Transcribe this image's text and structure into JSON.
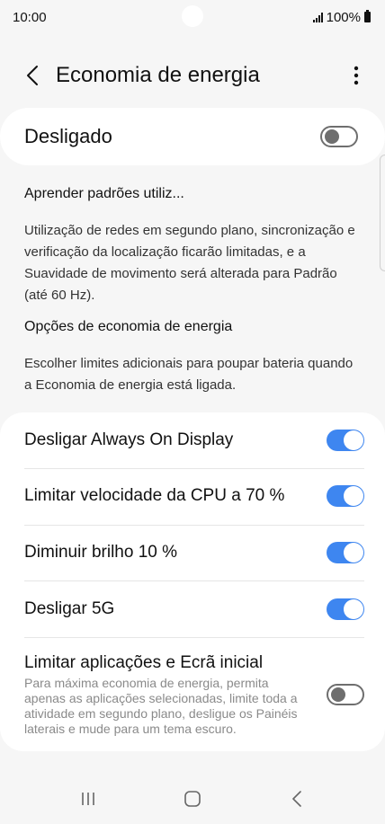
{
  "status_bar": {
    "time": "10:00",
    "battery_percent": "100%",
    "icons": [
      "signal-icon",
      "battery-icon"
    ]
  },
  "app_bar": {
    "title": "Economia de energia",
    "back_icon": "chevron-left-icon",
    "more_icon": "more-vertical-icon"
  },
  "master_switch": {
    "label": "Desligado",
    "on": false
  },
  "info": {
    "learn_heading": "Aprender padrões utiliz...",
    "learn_text": "Utilização de redes em segundo plano, sincronização e verificação da localização ficarão limitadas, e a Suavidade de movimento será alterada para Padrão (até 60 Hz).",
    "options_heading": "Opções de economia de energia",
    "options_text": "Escolher limites adicionais para poupar bateria quando a Economia de energia está ligada."
  },
  "options": [
    {
      "label": "Desligar Always On Display",
      "on": true
    },
    {
      "label": "Limitar velocidade da CPU a 70 %",
      "on": true
    },
    {
      "label": "Diminuir brilho 10 %",
      "on": true
    },
    {
      "label": "Desligar 5G",
      "on": true
    },
    {
      "label": "Limitar aplicações e Ecrã inicial",
      "sublabel": "Para máxima economia de energia, permita apenas as aplicações selecionadas, limite toda a atividade em segundo plano, desligue os Painéis laterais e mude para um tema escuro.",
      "on": false
    }
  ],
  "colors": {
    "accent": "#3e86f0",
    "background": "#f6f6f6",
    "card": "#ffffff"
  },
  "nav_bar": {
    "icons": [
      "recents-icon",
      "home-icon",
      "back-icon"
    ]
  }
}
